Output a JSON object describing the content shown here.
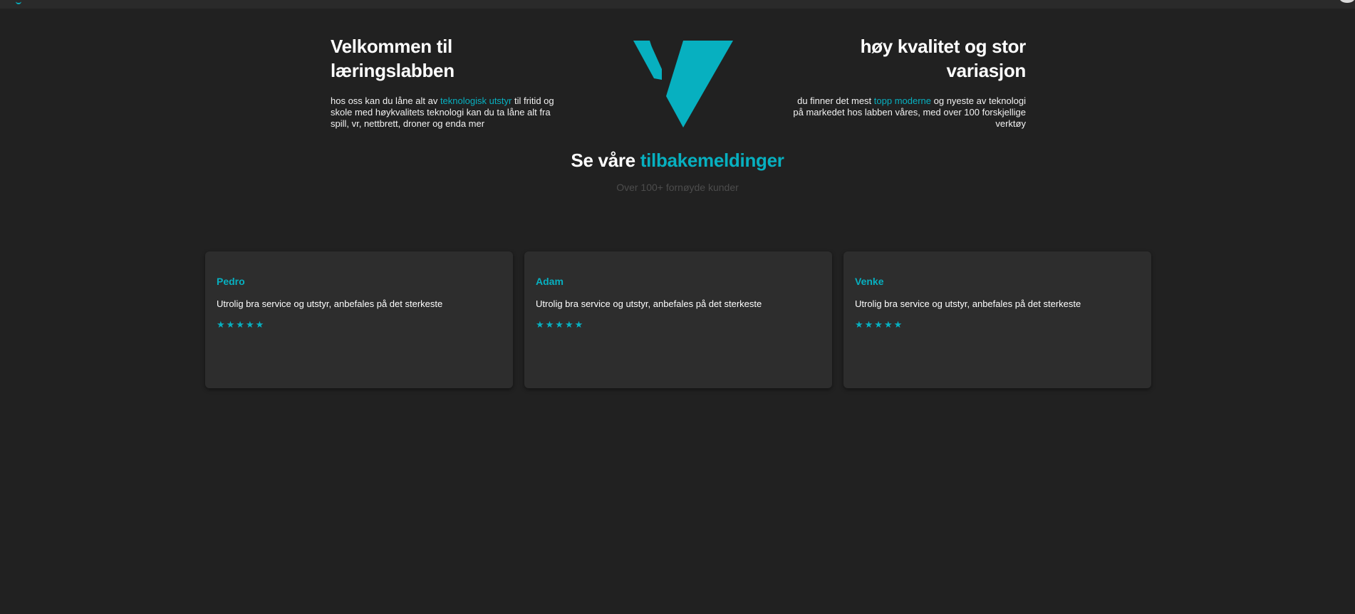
{
  "colors": {
    "background": "#212121",
    "card": "#2d2d2d",
    "accent": "#07b0c0",
    "muted": "#4c4c4c"
  },
  "hero_left": {
    "title": "Velkommen til læringslabben",
    "text_before": "hos oss kan du låne alt av ",
    "highlight": "teknologisk utstyr",
    "text_after": " til fritid og skole med høykvalitets teknologi kan du ta låne alt fra spill, vr, nettbrett, droner og enda mer"
  },
  "logo": {
    "icon": "v-logo-icon"
  },
  "hero_right": {
    "title": "høy kvalitet og stor variasjon",
    "text_before": "du finner det mest ",
    "highlight": "topp moderne",
    "text_after": " og nyeste av teknologi på markedet hos labben våres, med over 100 forskjellige verktøy"
  },
  "reviews": {
    "heading_plain": "Se våre ",
    "heading_accent": "tilbakemeldinger",
    "subtitle": "Over 100+ fornøyde kunder",
    "items": [
      {
        "name": "Pedro",
        "text": "Utrolig bra service og utstyr, anbefales på det sterkeste",
        "stars": "★★★★★",
        "rating": 5
      },
      {
        "name": "Adam",
        "text": "Utrolig bra service og utstyr, anbefales på det sterkeste",
        "stars": "★★★★★",
        "rating": 5
      },
      {
        "name": "Venke",
        "text": "Utrolig bra service og utstyr, anbefales på det sterkeste",
        "stars": "★★★★★",
        "rating": 5
      }
    ]
  }
}
